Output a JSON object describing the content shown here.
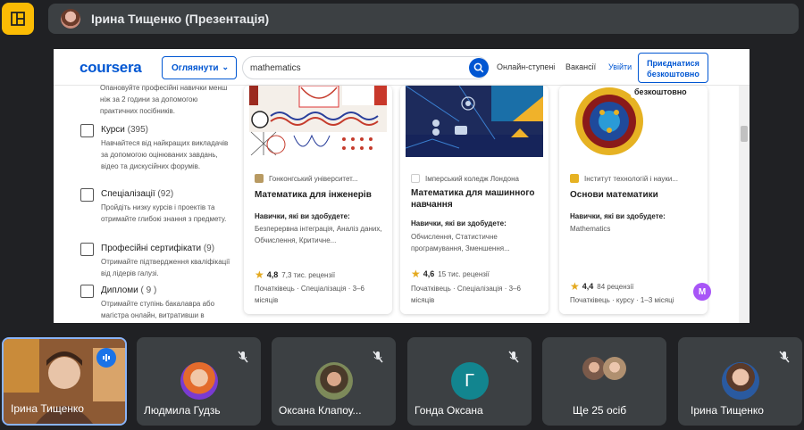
{
  "top": {
    "presenter_name": "Ірина Тищенко (Презентація)"
  },
  "coursera": {
    "logo": "coursera",
    "explore": "Огляянути",
    "search_value": "mathematics",
    "nav": [
      "Онлайн-ступені",
      "Вакансії",
      "Увійти"
    ],
    "join": "Приєднатися безкоштовно"
  },
  "filters": {
    "top_desc": "Опановуйте професійні навички менш ніж за 2 години за допомогою практичних посібників.",
    "items": [
      {
        "title": "Курси",
        "count": "(395)",
        "desc": "Навчайтеся від найкращих викладачів за допомогою оцінюваних завдань, відео та дискусійних форумів."
      },
      {
        "title": "Спеціалізації",
        "count": "(92)",
        "desc": "Пройдіть низку курсів і проектів та отримайте глибокі знання з предмету."
      },
      {
        "title": "Професійні сертифікати",
        "count": "(9)",
        "desc": "Отримайте підтвердження кваліфікації від лідерів галузі."
      },
      {
        "title": "Дипломи",
        "count": "( 9 )",
        "desc": "Отримайте ступінь бакалавра або магістра онлайн, витративши в"
      }
    ]
  },
  "cards": [
    {
      "partner": "Гонконгський університет...",
      "title": "Математика для інженерів",
      "skills_h": "Навички, які ви здобудете:",
      "skills": "Безперервна інтеграція, Аналіз даних, Обчислення, Критичне...",
      "rating": "4,8",
      "reviews": "7,3 тис. рецензії",
      "meta": "Початківець · Спеціалізація · 3–6 місяців"
    },
    {
      "partner": "Імперський коледж Лондона",
      "title": "Математика для машинного навчання",
      "skills_h": "Навички, які ви здобудете:",
      "skills": "Обчислення, Статистичне програмування, Зменшення...",
      "rating": "4,6",
      "reviews": "15 тис. рецензії",
      "meta": "Початківець · Спеціалізація · 3–6 місяців"
    },
    {
      "badge": "безкоштовно",
      "partner": "Інститут технологій і науки...",
      "title": "Основи математики",
      "skills_h": "Навички, які ви здобудете:",
      "skills": "Mathematics",
      "rating": "4,4",
      "reviews": "84 рецензії",
      "meta": "Початківець · курсу · 1–3 місяці"
    }
  ],
  "m_badge": "M",
  "tiles": [
    {
      "name": "Ірина Тищенко"
    },
    {
      "name": "Людмила Гудзь"
    },
    {
      "name": "Оксана Клапоу..."
    },
    {
      "name": "Гонда Оксана",
      "letter": "Г"
    },
    {
      "name": "Ще 25 осіб"
    },
    {
      "name": "Ірина Тищенко"
    }
  ],
  "colors": {
    "meet_bg": "#202124",
    "tile_bg": "#3c4043",
    "accent_yellow": "#fbbc04",
    "coursera_blue": "#0056d2",
    "active_speaker": "#8ab4f8",
    "teal_avatar": "#12858f"
  }
}
